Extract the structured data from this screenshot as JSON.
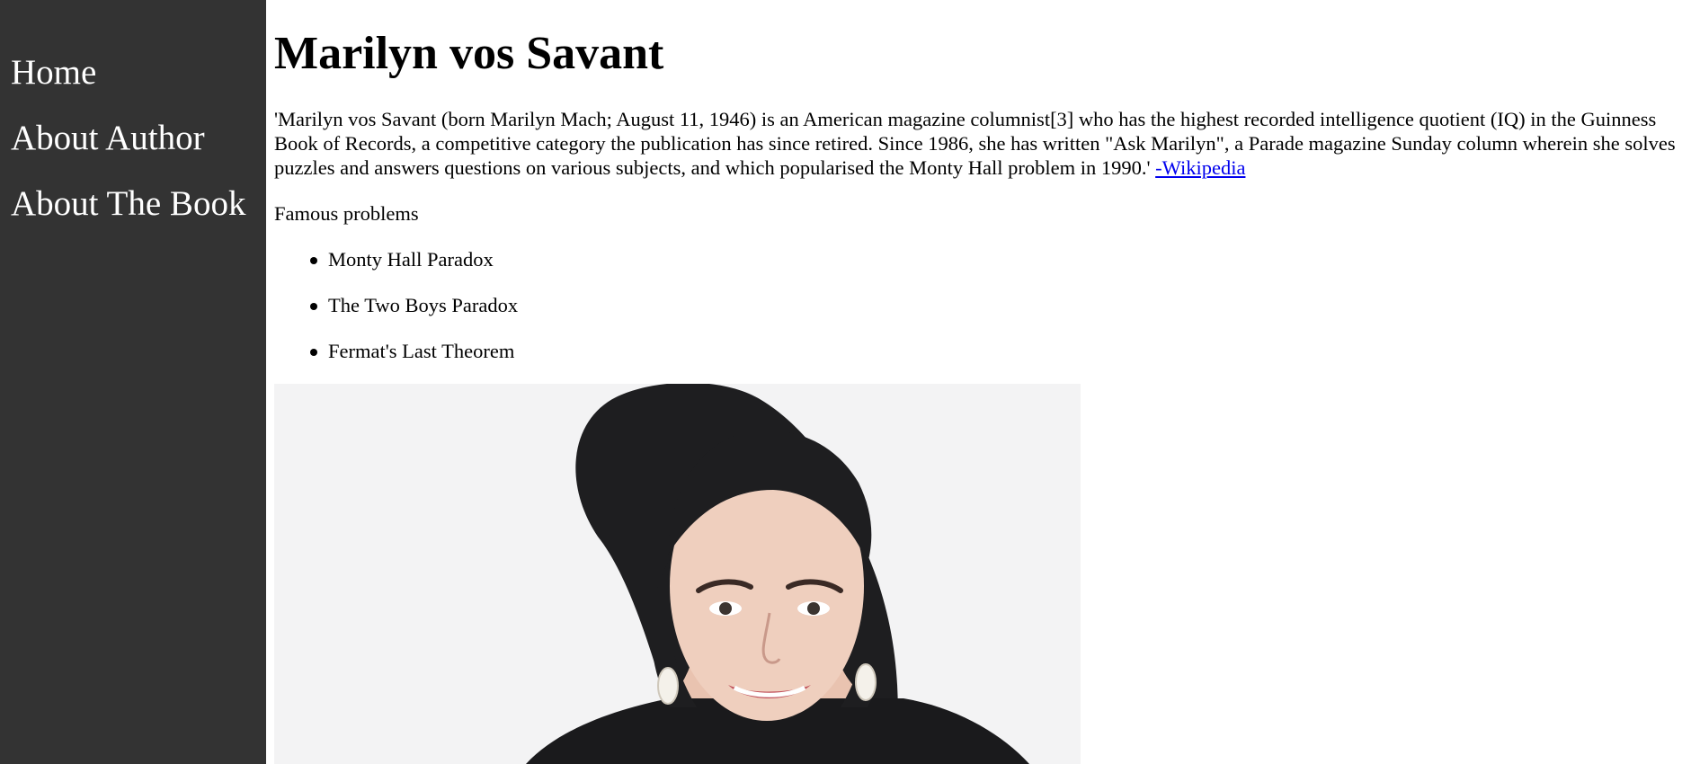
{
  "sidebar": {
    "items": [
      {
        "label": "Home"
      },
      {
        "label": "About Author"
      },
      {
        "label": "About The Book"
      }
    ]
  },
  "main": {
    "title": "Marilyn vos Savant",
    "intro_text": "'Marilyn vos Savant (born Marilyn Mach; August 11, 1946) is an American magazine columnist[3] who has the highest recorded intelligence quotient (IQ) in the Guinness Book of Records, a competitive category the publication has since retired. Since 1986, she has written \"Ask Marilyn\", a Parade magazine Sunday column wherein she solves puzzles and answers questions on various subjects, and which popularised the Monty Hall problem in 1990.'",
    "source_link": "-Wikipedia",
    "section_label": "Famous problems",
    "problems": [
      "Monty Hall Paradox",
      "The Two Boys Paradox",
      "Fermat's Last Theorem"
    ]
  },
  "colors": {
    "sidebar_background": "#333333",
    "sidebar_text": "#ffffff",
    "link": "#0000ee",
    "photo_background": "#f3f3f4"
  }
}
